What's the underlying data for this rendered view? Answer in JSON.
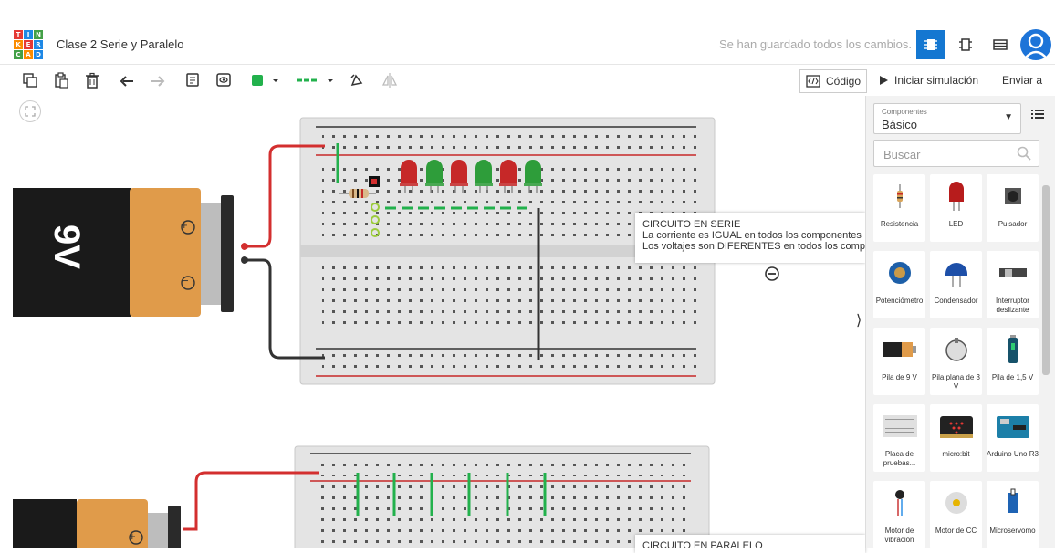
{
  "app": {
    "logo_letters": [
      "T",
      "I",
      "N",
      "K",
      "E",
      "R",
      "C",
      "A",
      "D"
    ],
    "project_title": "Clase 2 Serie y Paralelo",
    "save_status": "Se han guardado todos los cambios."
  },
  "toolbar": {
    "code_label": "Código",
    "simulate_label": "Iniciar simulación",
    "send_label": "Enviar a",
    "fill_color": "#22b14c",
    "wire_color": "#22b14c"
  },
  "components_panel": {
    "category_caption": "Componentes",
    "category_value": "Básico",
    "search_placeholder": "Buscar",
    "items": [
      {
        "label": "Resistencia",
        "icon": "resistor-icon"
      },
      {
        "label": "LED",
        "icon": "led-icon"
      },
      {
        "label": "Pulsador",
        "icon": "pushbutton-icon"
      },
      {
        "label": "Potenciómetro",
        "icon": "potentiometer-icon"
      },
      {
        "label": "Condensador",
        "icon": "capacitor-icon"
      },
      {
        "label": "Interruptor deslizante",
        "icon": "slide-switch-icon"
      },
      {
        "label": "Pila de 9 V",
        "icon": "battery-9v-icon"
      },
      {
        "label": "Pila plana de 3 V",
        "icon": "coin-cell-icon"
      },
      {
        "label": "Pila de 1,5 V",
        "icon": "battery-aa-icon"
      },
      {
        "label": "Placa de pruebas...",
        "icon": "breadboard-icon"
      },
      {
        "label": "micro:bit",
        "icon": "microbit-icon"
      },
      {
        "label": "Arduino Uno R3",
        "icon": "arduino-icon"
      },
      {
        "label": "Motor de vibración",
        "icon": "vibration-motor-icon"
      },
      {
        "label": "Motor de CC",
        "icon": "dc-motor-icon"
      },
      {
        "label": "Microservomo",
        "icon": "microservo-icon"
      }
    ]
  },
  "canvas": {
    "battery_label": "9V",
    "plus_sign": "+",
    "minus_sign": "−",
    "note_series": {
      "title": "CIRCUITO EN SERIE",
      "line1": "La corriente es IGUAL en todos los componentes",
      "line2": "Los voltajes son DIFERENTES en todos los comp"
    },
    "note_parallel": {
      "title": "CIRCUITO EN PARALELO"
    },
    "led_colors": [
      "#c62828",
      "#2e9d3a",
      "#c62828",
      "#2e9d3a",
      "#c62828",
      "#2e9d3a"
    ]
  }
}
